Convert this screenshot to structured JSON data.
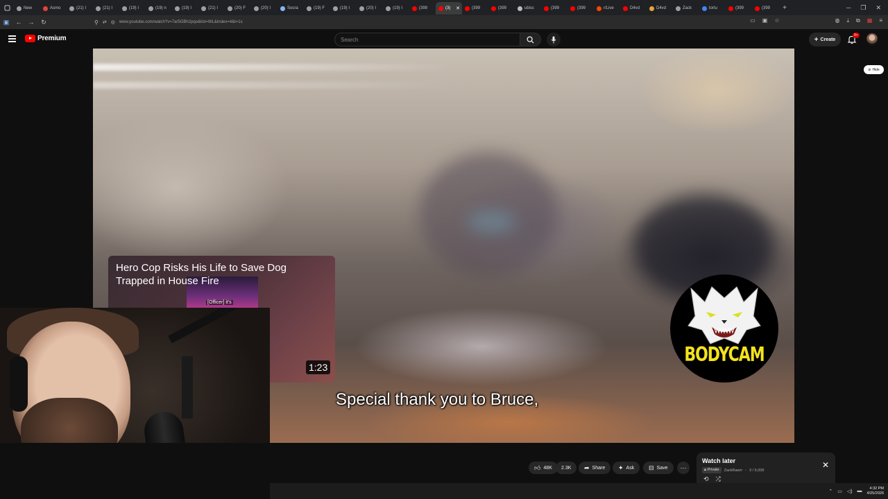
{
  "browser": {
    "tabs": [
      {
        "label": "New",
        "color": "#9aa0a6"
      },
      {
        "label": "Asmo",
        "color": "#e0453a"
      },
      {
        "label": "(21) I",
        "color": "#9aa0a6"
      },
      {
        "label": "(21) I",
        "color": "#9aa0a6"
      },
      {
        "label": "(19) I",
        "color": "#9aa0a6"
      },
      {
        "label": "(19) n",
        "color": "#9aa0a6"
      },
      {
        "label": "(19) I",
        "color": "#9aa0a6"
      },
      {
        "label": "(21) I",
        "color": "#9aa0a6"
      },
      {
        "label": "(20) F",
        "color": "#9aa0a6"
      },
      {
        "label": "(20) I",
        "color": "#9aa0a6"
      },
      {
        "label": "Socra",
        "color": "#8ab4f8"
      },
      {
        "label": "(19) F",
        "color": "#9aa0a6"
      },
      {
        "label": "(19) I",
        "color": "#9aa0a6"
      },
      {
        "label": "(20) I",
        "color": "#9aa0a6"
      },
      {
        "label": "(19) I",
        "color": "#9aa0a6"
      },
      {
        "label": "(399",
        "color": "#ff0000"
      },
      {
        "label": "(3)",
        "color": "#ff0000",
        "active": true
      },
      {
        "label": "(399",
        "color": "#ff0000"
      },
      {
        "label": "(399",
        "color": "#ff0000"
      },
      {
        "label": "ubisc",
        "color": "#bbbbbb"
      },
      {
        "label": "(399",
        "color": "#ff0000"
      },
      {
        "label": "(399",
        "color": "#ff0000"
      },
      {
        "label": "r/Live",
        "color": "#ff4500"
      },
      {
        "label": "D4vd",
        "color": "#ff0000"
      },
      {
        "label": "D4vd",
        "color": "#e8a33a"
      },
      {
        "label": "Zack",
        "color": "#9aa0a6"
      },
      {
        "label": "tortu",
        "color": "#4285f4"
      },
      {
        "label": "(399",
        "color": "#ff0000"
      },
      {
        "label": "(399",
        "color": "#ff0000"
      }
    ],
    "url": "www.youtube.com/watch?v=7ar5GBh2pqo&list=WL&index=4&t=1s"
  },
  "masthead": {
    "brand": "Premium",
    "search_placeholder": "Search",
    "create_label": "Create",
    "notification_count": "9+"
  },
  "player": {
    "caption": "Special thank you to Bruce,",
    "channel_logo_text": "BODYCAM",
    "hide_label": "Hide"
  },
  "endscreen": {
    "title": "Hero Cop Risks His Life to Save Dog Trapped in House Fire",
    "thumb_text": "[Officer] it's",
    "duration": "1:23"
  },
  "actions": {
    "likes": "48K",
    "dislike_count": "2.3K",
    "share_label": "Share",
    "ask_label": "Ask",
    "save_label": "Save"
  },
  "watch_later": {
    "title": "Watch later",
    "privacy": "Private",
    "owner": "ZackRawrr",
    "progress": "3 / 5,000"
  },
  "taskbar": {
    "time": "4:32 PM",
    "date": "4/25/2026"
  }
}
